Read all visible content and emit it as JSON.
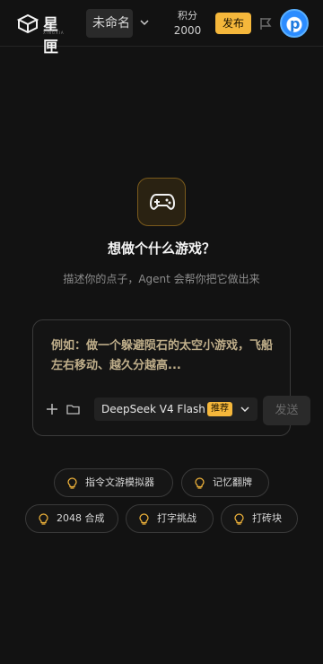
{
  "header": {
    "logo_text": "星匣",
    "logo_sub": "XINGXIA",
    "project_title": "未命名",
    "credits_label": "积分",
    "credits_value": "2000",
    "publish_label": "发布",
    "avatar_glyph": "p"
  },
  "hero": {
    "title": "想做个什么游戏？",
    "subtitle": "描述你的点子，Agent 会帮你把它做出来"
  },
  "prompt": {
    "placeholder": "例如：做一个躲避陨石的太空小游戏，飞船左右移动、越久分越高...",
    "model_name": "DeepSeek V4 Flash",
    "model_badge": "推荐",
    "send_label": "发送"
  },
  "suggestions": [
    {
      "label": "指令文游模拟器"
    },
    {
      "label": "记忆翻牌"
    },
    {
      "label": "2048 合成"
    },
    {
      "label": "打字挑战"
    },
    {
      "label": "打砖块"
    }
  ],
  "colors": {
    "accent": "#f5b73b",
    "background": "#121212"
  }
}
